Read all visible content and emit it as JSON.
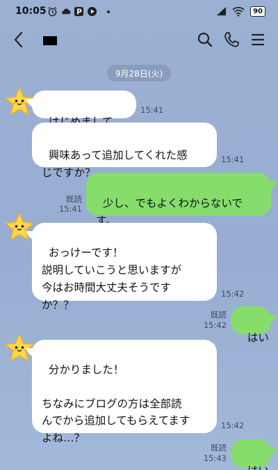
{
  "status_bar": {
    "time": "10:05",
    "battery": "90",
    "icons": [
      "alarm-icon",
      "cloud-icon",
      "p-badge-icon",
      "play-icon",
      "dot-icon",
      "signal-icon",
      "wifi-icon",
      "battery-icon"
    ]
  },
  "header": {
    "icons": [
      "back-icon",
      "search-icon",
      "phone-icon",
      "menu-icon"
    ]
  },
  "date_chip": "9月28日(火)",
  "messages": [
    {
      "side": "in",
      "text": "はじめまして",
      "emoji": "smile-emoji",
      "time": "15:41"
    },
    {
      "side": "in",
      "text": "興味あって追加してくれた感\nじですか？",
      "time": "15:41"
    },
    {
      "side": "out",
      "text": "少し、でもよくわからないで\nす。",
      "read": "既読",
      "time": "15:41"
    },
    {
      "side": "in",
      "text": "おっけーです！\n説明していこうと思いますが\n今はお時間大丈夫そうです\nか？？",
      "time": "15:42"
    },
    {
      "side": "out",
      "text": "はい",
      "read": "既読",
      "time": "15:42"
    },
    {
      "side": "in",
      "text": "分かりました！\n\nちなみにブログの方は全部読\nんでから追加してもらえてます\nよね…？",
      "time": "15:42"
    },
    {
      "side": "out",
      "text": "はい",
      "read": "既読",
      "time": "15:43"
    }
  ],
  "colors": {
    "background": "#9bb0d3",
    "incoming_bubble": "#ffffff",
    "outgoing_bubble": "#86dd6c",
    "avatar_star": "#ffd84a"
  }
}
